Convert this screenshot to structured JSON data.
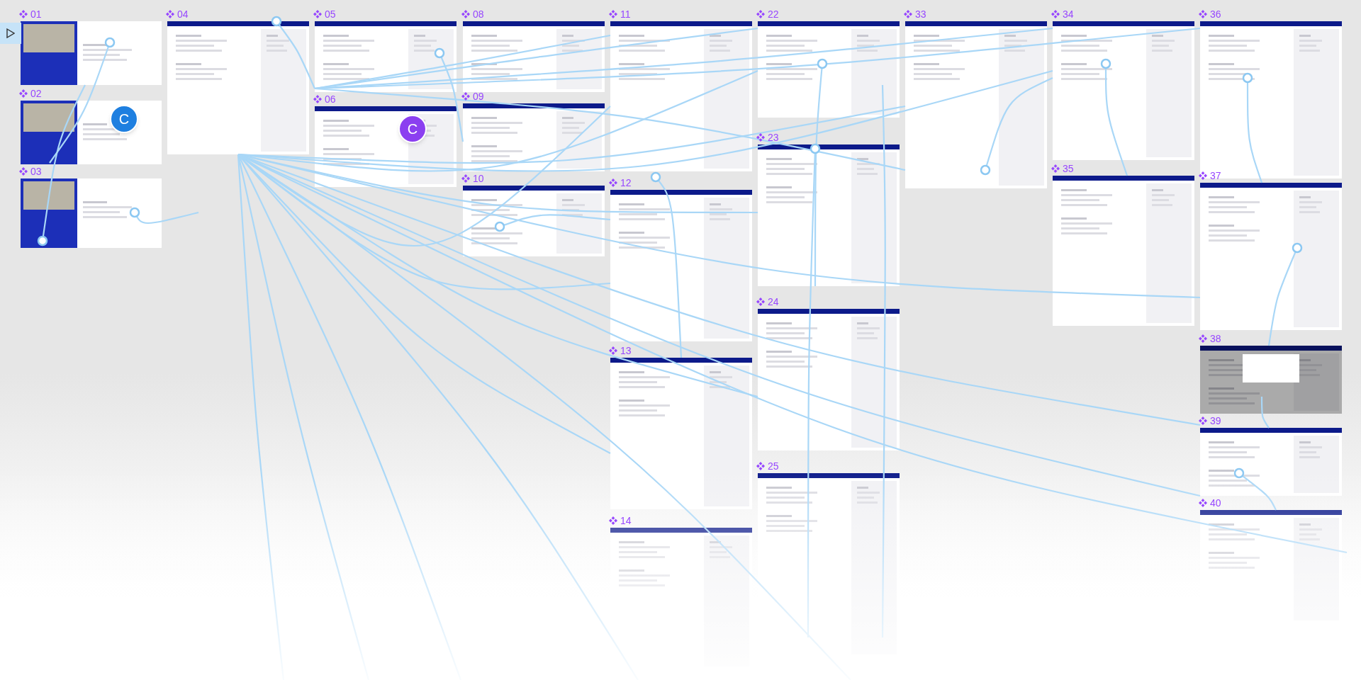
{
  "frames": [
    {
      "label": "01",
      "kind": "login"
    },
    {
      "label": "02",
      "kind": "login"
    },
    {
      "label": "03",
      "kind": "login"
    },
    {
      "label": "04",
      "kind": "app"
    },
    {
      "label": "05",
      "kind": "app"
    },
    {
      "label": "06",
      "kind": "app"
    },
    {
      "label": "08",
      "kind": "app"
    },
    {
      "label": "09",
      "kind": "app"
    },
    {
      "label": "10",
      "kind": "app"
    },
    {
      "label": "11",
      "kind": "app"
    },
    {
      "label": "12",
      "kind": "app"
    },
    {
      "label": "13",
      "kind": "app"
    },
    {
      "label": "14",
      "kind": "app"
    },
    {
      "label": "22",
      "kind": "app"
    },
    {
      "label": "23",
      "kind": "app"
    },
    {
      "label": "24",
      "kind": "app"
    },
    {
      "label": "25",
      "kind": "app"
    },
    {
      "label": "33",
      "kind": "app"
    },
    {
      "label": "34",
      "kind": "app"
    },
    {
      "label": "35",
      "kind": "app"
    },
    {
      "label": "36",
      "kind": "app"
    },
    {
      "label": "37",
      "kind": "app"
    },
    {
      "label": "38",
      "kind": "modal"
    },
    {
      "label": "39",
      "kind": "app"
    },
    {
      "label": "40",
      "kind": "app"
    }
  ],
  "avatars": [
    {
      "initial": "C",
      "color": "#1e7fe0"
    },
    {
      "initial": "C",
      "color": "#8b3ff0"
    }
  ]
}
